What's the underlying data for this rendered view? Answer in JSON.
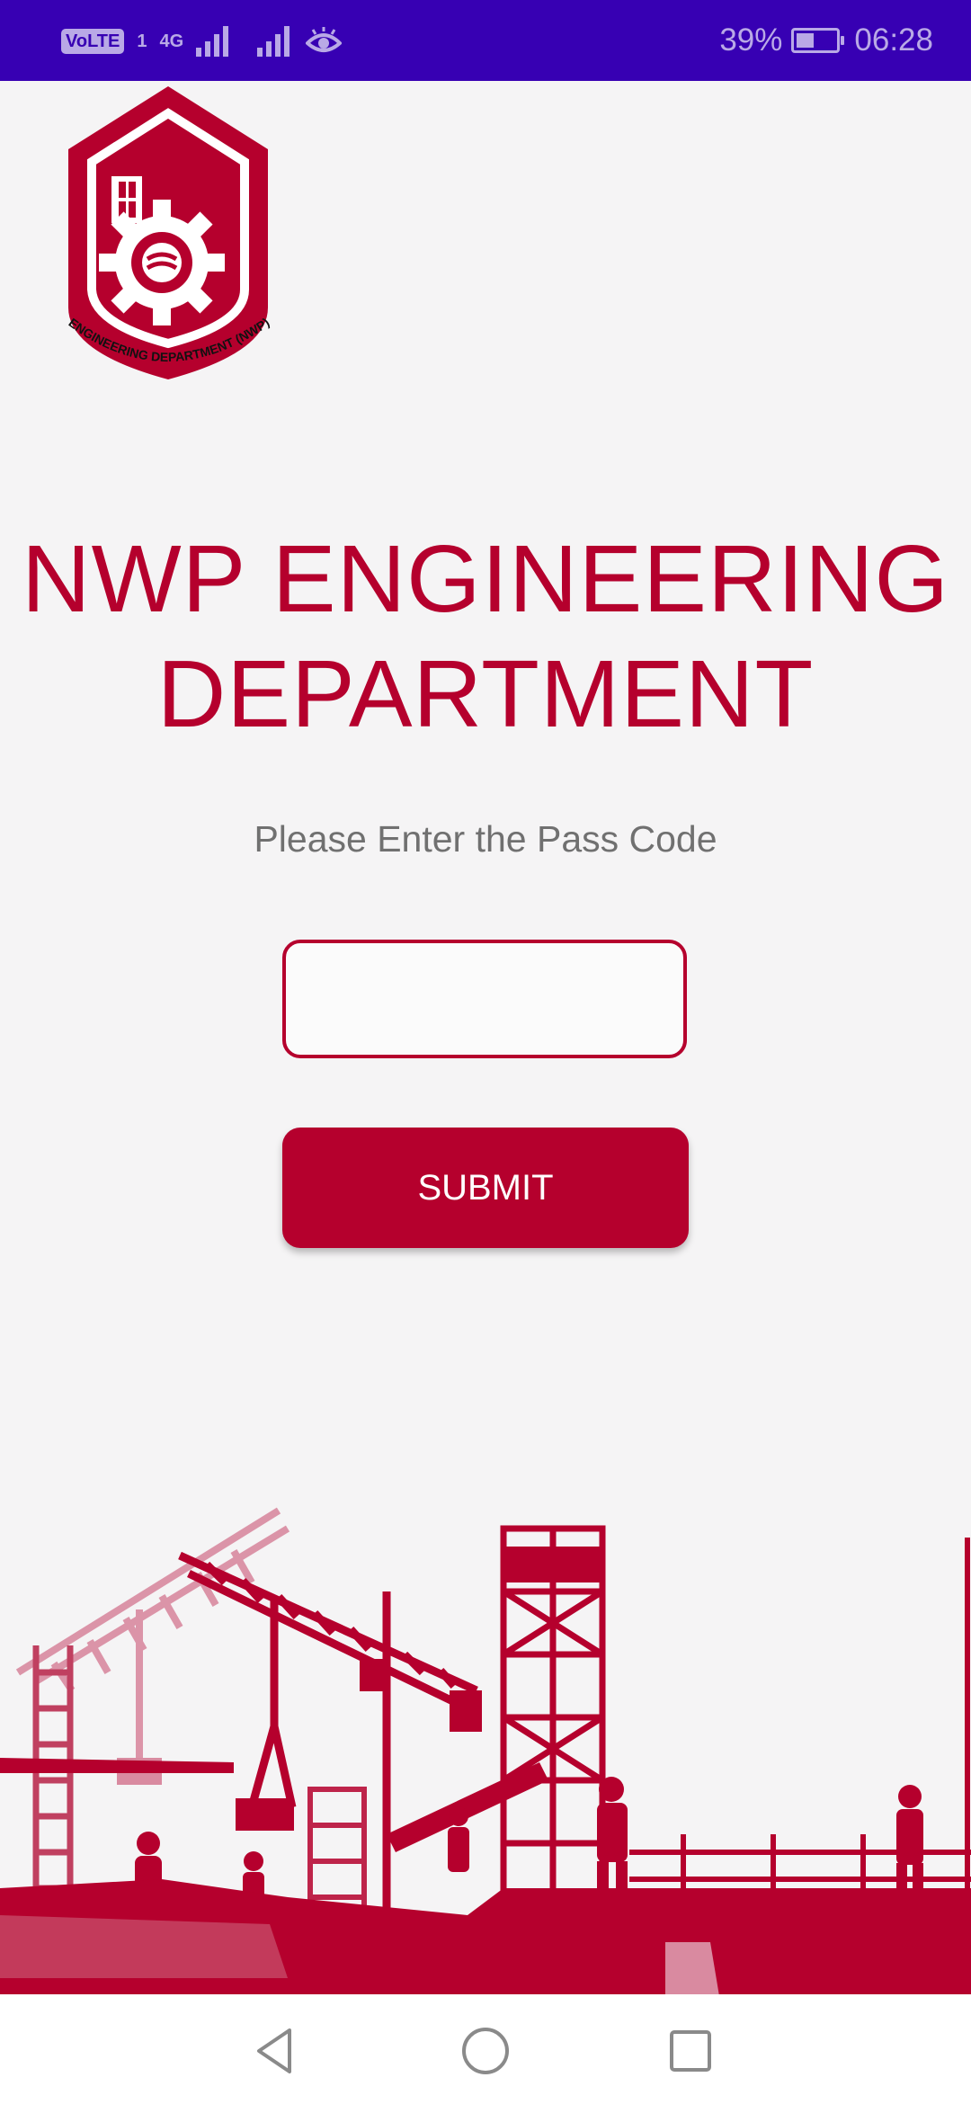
{
  "status_bar": {
    "volte": "VoLTE",
    "sim_index": "1",
    "network_type": "4G",
    "battery_percent": "39%",
    "time": "06:28",
    "battery_level": 0.39,
    "icons": [
      "volte-icon",
      "signal-icon",
      "signal-icon",
      "eye-comfort-icon",
      "battery-charging-icon"
    ]
  },
  "logo": {
    "ring_text": "ENGINEERING DEPARTMENT (NWP)",
    "icon": "shield-gear-logo"
  },
  "main": {
    "title_line1": "NWP ENGINEERING",
    "title_line2": "DEPARTMENT",
    "prompt": "Please Enter the Pass Code",
    "passcode_value": "",
    "passcode_placeholder": "",
    "submit_label": "SUBMIT"
  },
  "nav_bar": {
    "icons": [
      "back-icon",
      "home-icon",
      "recents-icon"
    ]
  },
  "colors": {
    "status_bar": "#3700b3",
    "brand_red": "#b5002d",
    "background": "#f5f4f5",
    "prompt_text": "#707070"
  }
}
